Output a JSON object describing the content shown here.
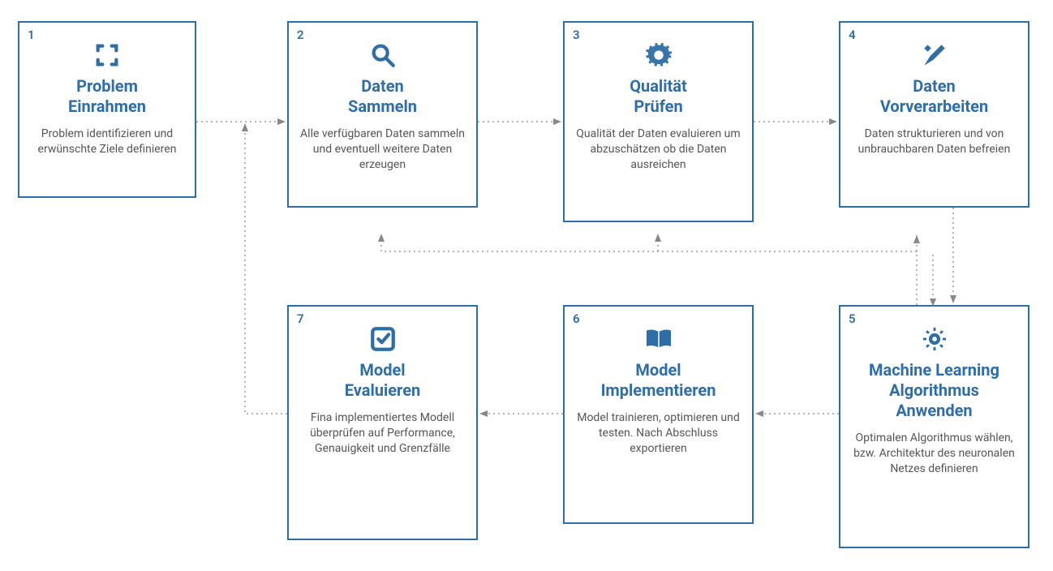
{
  "boxes": [
    {
      "n": "1",
      "icon": "frame",
      "title": "Problem\nEinrahmen",
      "desc": "Problem identifizieren und erwünschte Ziele definieren"
    },
    {
      "n": "2",
      "icon": "search",
      "title": "Daten\nSammeln",
      "desc": "Alle verfügbaren Daten sammeln und eventuell weitere Daten erzeugen"
    },
    {
      "n": "3",
      "icon": "gear",
      "title": "Qualität\nPrüfen",
      "desc": "Qualität der Daten evaluieren um abzu­schätzen ob die Daten ausreichen"
    },
    {
      "n": "4",
      "icon": "tools",
      "title": "Daten\nVorverarbeiten",
      "desc": "Daten strukturieren und von unbrauchbaren Daten befreien"
    },
    {
      "n": "5",
      "icon": "brain",
      "title": "Machine Learning\nAlgorithmus\nAnwenden",
      "desc": "Optimalen Algorithmus wählen, bzw. Architektur des neuronalen Netzes definieren"
    },
    {
      "n": "6",
      "icon": "book",
      "title": "Model\nImplementieren",
      "desc": "Model trainieren, optimieren und testen. Nach Abschluss exportieren"
    },
    {
      "n": "7",
      "icon": "check",
      "title": "Model\nEvaluieren",
      "desc": "Fina implementiertes Modell überprüfen auf Performance, Genauigkeit und Grenzfälle"
    }
  ],
  "colors": {
    "primary": "#2f6ea5",
    "text": "#555",
    "arrow": "#888"
  }
}
